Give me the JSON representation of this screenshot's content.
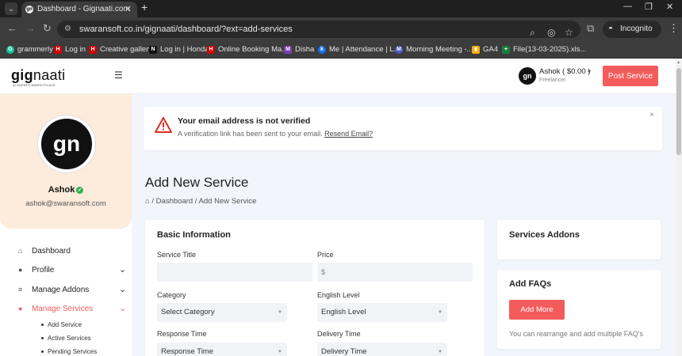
{
  "browser": {
    "tab_title": "Dashboard - Gignaati.com",
    "url": "swaransoft.co.in/gignaati/dashboard/?ext=add-services",
    "incognito_label": "Incognito (3)",
    "bookmarks": [
      {
        "label": "grammerly",
        "icon": "G",
        "color": "#15c39a"
      },
      {
        "label": "Log in",
        "icon": "H",
        "color": "#cc0000"
      },
      {
        "label": "Creative gallery",
        "icon": "H",
        "color": "#cc0000"
      },
      {
        "label": "Log in | Honda",
        "icon": "N",
        "color": "#111111"
      },
      {
        "label": "Online Booking Ma...",
        "icon": "H",
        "color": "#cc0000"
      },
      {
        "label": "Disha",
        "icon": "M",
        "color": "#7b3fb5"
      },
      {
        "label": "Me | Attendance | L...",
        "icon": "k",
        "color": "#1a73e8"
      },
      {
        "label": "Morning Meeting -...",
        "icon": "M",
        "color": "#5059c9"
      },
      {
        "label": "GA4",
        "icon": "▮",
        "color": "#f9ab00"
      },
      {
        "label": "File(13-03-2025).xls...",
        "icon": "+",
        "color": "#188038"
      }
    ]
  },
  "header": {
    "logo_main": "gig",
    "logo_accent": "naati",
    "logo_sub": "AI AGENTS MARKETPLACE",
    "user_name": "Ashok ( $0.00 )",
    "user_role": "Freelancer",
    "avatar_text": "gn",
    "post_button": "Post Service"
  },
  "sidebar": {
    "avatar_text": "gn",
    "name": "Ashok",
    "email": "ashok@swaransoft.com",
    "menu": [
      {
        "label": "Dashboard",
        "icon": "⌂",
        "chevron": ""
      },
      {
        "label": "Profile",
        "icon": "●",
        "chevron": "⌄"
      },
      {
        "label": "Manage Addons",
        "icon": "≡",
        "chevron": "⌄"
      },
      {
        "label": "Manage Services",
        "icon": "●",
        "chevron": "⌄"
      }
    ],
    "submenu": [
      "Add Service",
      "Active Services",
      "Pending Services"
    ]
  },
  "alert": {
    "title": "Your email address is not verified",
    "message": "A verification link has been sent to your email.",
    "link": "Resend Email?",
    "close": "×"
  },
  "main": {
    "title": "Add New Service",
    "breadcrumb": "/ Dashboard / Add New Service",
    "basic": {
      "heading": "Basic Information",
      "service_title_label": "Service Title",
      "price_label": "Price",
      "price_prefix": "$",
      "category_label": "Category",
      "category_value": "Select Category",
      "english_label": "English Level",
      "english_value": "English Level",
      "response_label": "Response Time",
      "response_value": "Response Time",
      "delivery_label": "Delivery Time",
      "delivery_value": "Delivery Time"
    },
    "addons": {
      "heading": "Services Addons"
    },
    "faqs": {
      "heading": "Add FAQs",
      "button": "Add More",
      "note": "You can rearrange and add multiple FAQ's"
    }
  },
  "colors": {
    "accent": "#f45b5b",
    "profile_bg": "#fdebdc",
    "page_bg": "#f2f5fb"
  }
}
